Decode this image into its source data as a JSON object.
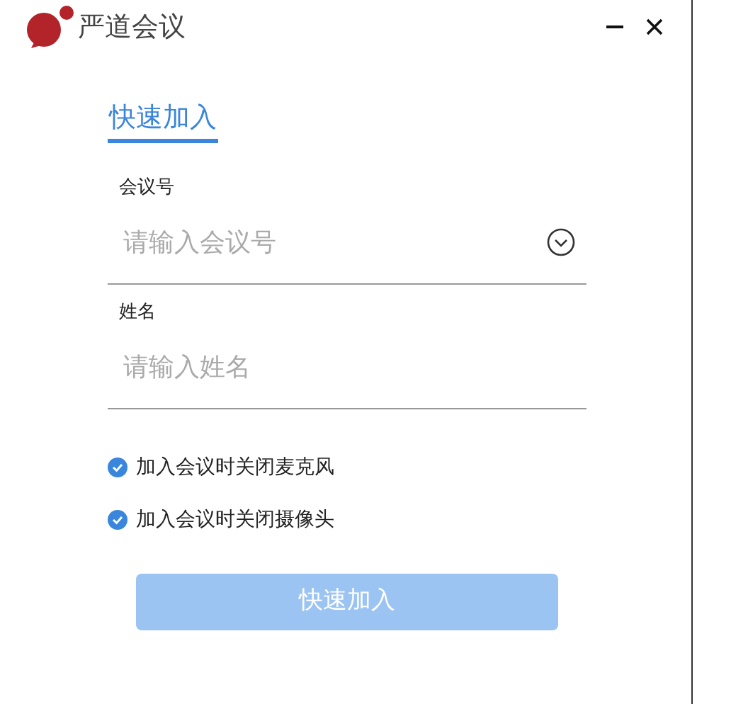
{
  "window": {
    "title": "严道会议"
  },
  "tabs": [
    {
      "label": "快速加入",
      "selected": true
    }
  ],
  "fields": [
    {
      "label": "会议号",
      "placeholder": "请输入会议号",
      "kind": "dropdown"
    },
    {
      "label": "姓名",
      "placeholder": "请输入姓名",
      "kind": "text"
    }
  ],
  "options": [
    {
      "label": "加入会议时关闭麦克风",
      "checked": true
    },
    {
      "label": "加入会议时关闭摄像头",
      "checked": true
    }
  ],
  "submit": {
    "label": "快速加入",
    "disabled": true
  }
}
